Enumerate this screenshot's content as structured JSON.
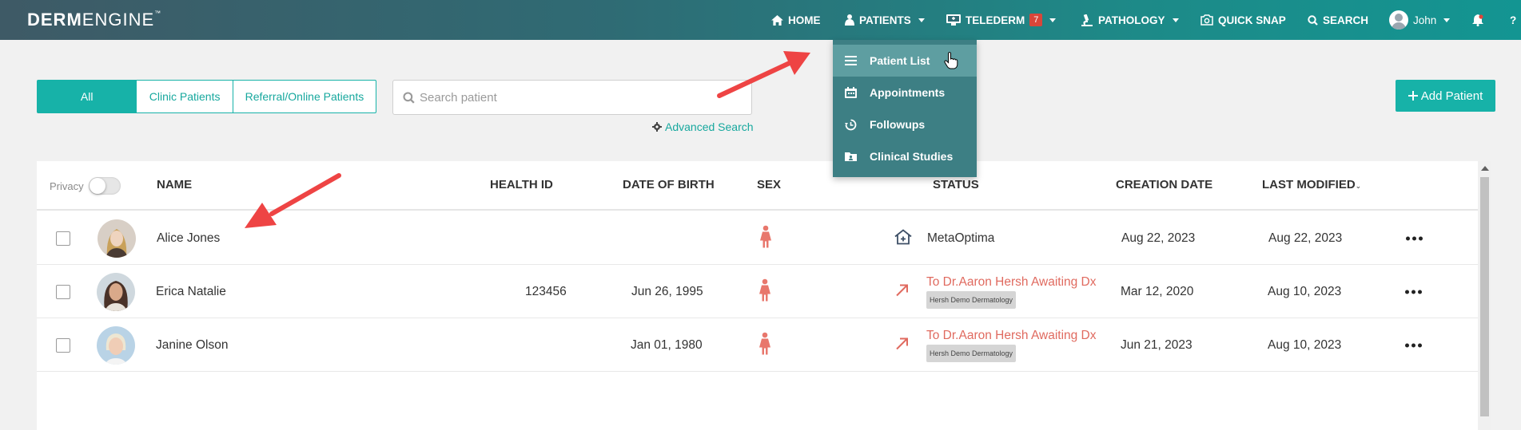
{
  "brand": {
    "logo_bold": "DERM",
    "logo_light": "ENGINE",
    "logo_tm": "™"
  },
  "nav": {
    "home": "HOME",
    "patients": "PATIENTS",
    "telederm": "TELEDERM",
    "telederm_badge": "7",
    "pathology": "PATHOLOGY",
    "quick_snap": "QUICK SNAP",
    "search": "SEARCH",
    "user": "John",
    "help": "?"
  },
  "patients_menu": {
    "items": [
      "Patient List",
      "Appointments",
      "Followups",
      "Clinical Studies"
    ],
    "active": "Patient List"
  },
  "filters": {
    "tabs": [
      "All",
      "Clinic Patients",
      "Referral/Online Patients"
    ],
    "selected": "All"
  },
  "search": {
    "placeholder": "Search patient",
    "value": ""
  },
  "advanced_search": "Advanced Search",
  "add_patient": "Add Patient",
  "table": {
    "privacy_label": "Privacy",
    "privacy_on": false,
    "columns": [
      "NAME",
      "HEALTH ID",
      "DATE OF BIRTH",
      "SEX",
      "STATUS",
      "CREATION DATE",
      "LAST MODIFIED"
    ],
    "sort_column": "LAST MODIFIED",
    "rows": [
      {
        "name": "Alice Jones",
        "health_id": "",
        "dob": "",
        "sex": "female",
        "status_type": "clinic",
        "status": "MetaOptima",
        "status_tag": "",
        "created": "Aug 22, 2023",
        "modified": "Aug 22, 2023"
      },
      {
        "name": "Erica Natalie",
        "health_id": "123456",
        "dob": "Jun 26, 1995",
        "sex": "female",
        "status_type": "referral",
        "status": "To Dr.Aaron Hersh Awaiting Dx",
        "status_tag": "Hersh Demo Dermatology",
        "created": "Mar 12, 2020",
        "modified": "Aug 10, 2023"
      },
      {
        "name": "Janine Olson",
        "health_id": "",
        "dob": "Jan 01, 1980",
        "sex": "female",
        "status_type": "referral",
        "status": "To Dr.Aaron Hersh Awaiting Dx",
        "status_tag": "Hersh Demo Dermatology",
        "created": "Jun 21, 2023",
        "modified": "Aug 10, 2023"
      }
    ]
  },
  "colors": {
    "accent": "#17b2a8",
    "status_referral": "#e06a5f",
    "female_icon": "#e8776c",
    "annotation_arrow": "#ee4444"
  }
}
